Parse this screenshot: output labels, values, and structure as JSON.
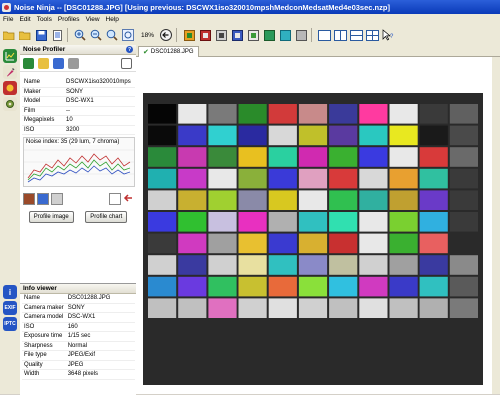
{
  "window": {
    "title": "Noise Ninja -- [DSC01288.JPG] [Using previous: DSCWX1iso320010mpshMedconMedsatMed4e03sec.nzp]"
  },
  "menu": [
    "File",
    "Edit",
    "Tools",
    "Profiles",
    "View",
    "Help"
  ],
  "toolbar": {
    "zoom": "18%"
  },
  "left_strip": {
    "exif": "EXIF",
    "iptc": "IPTC"
  },
  "noise_profiler": {
    "title": "Noise Profiler",
    "help": "?",
    "rows": [
      {
        "key": "Name",
        "value": "DSCWX1iso320010mps"
      },
      {
        "key": "Maker",
        "value": "SONY"
      },
      {
        "key": "Model",
        "value": "DSC-WX1"
      },
      {
        "key": "Film",
        "value": "--"
      },
      {
        "key": "Megapixels",
        "value": "10"
      },
      {
        "key": "ISO",
        "value": "3200"
      }
    ],
    "noise_index": "Noise index:  35 (29 lum, 7 chroma)",
    "profile_image_button": "Profile image",
    "profile_chart_button": "Profile chart"
  },
  "info_viewer": {
    "title": "Info viewer",
    "rows": [
      {
        "key": "Name",
        "value": "DSC01288.JPG"
      },
      {
        "key": "Camera maker",
        "value": "SONY"
      },
      {
        "key": "Camera model",
        "value": "DSC-WX1"
      },
      {
        "key": "ISO",
        "value": "160"
      },
      {
        "key": "Exposure time",
        "value": "1/15 sec"
      },
      {
        "key": "Sharpness",
        "value": "Normal"
      },
      {
        "key": "File type",
        "value": "JPEG/Exif"
      },
      {
        "key": "Quality",
        "value": "JPEG"
      },
      {
        "key": "Width",
        "value": "3648 pixels"
      }
    ]
  },
  "tab": {
    "label": "DSC01288.JPG"
  },
  "colors": {
    "chart": [
      [
        "#050505",
        "#e8e8e8",
        "#7a7a7a",
        "#2a8b2a",
        "#d23a3a",
        "#c88a8a",
        "#3a3a9a",
        "#ff3aa0",
        "#e8e8e8",
        "#3a3a3a",
        "#606060"
      ],
      [
        "#0a0a0a",
        "#3a3ac8",
        "#30d0d0",
        "#2a2aa0",
        "#d8d8d8",
        "#c0c02a",
        "#5a3aa0",
        "#2ac8c0",
        "#e8e820",
        "#1a1a1a",
        "#4a4a4a"
      ],
      [
        "#2a8a3a",
        "#c83ab0",
        "#3a8a3a",
        "#e8c020",
        "#2ad0a0",
        "#d02ab0",
        "#3ab030",
        "#3a3ae0",
        "#e8e8e8",
        "#d83a3a",
        "#6a6a6a"
      ],
      [
        "#20b0b0",
        "#c83ac8",
        "#e8e8e8",
        "#8ab03a",
        "#3a3ad8",
        "#e0a0c0",
        "#d83a3a",
        "#d8d8d8",
        "#e8a030",
        "#30c0a0",
        "#3a3a3a"
      ],
      [
        "#d0d0d0",
        "#c8b030",
        "#a0d030",
        "#8a8aa8",
        "#d8c820",
        "#e8e8e8",
        "#30c050",
        "#30b0a0",
        "#c0a030",
        "#6a3ac8",
        "#3a3a3a"
      ],
      [
        "#3a3ae0",
        "#30c030",
        "#c8c0e0",
        "#e830c0",
        "#b0b0b0",
        "#30c0c0",
        "#30e0b0",
        "#e8e8e8",
        "#7ad030",
        "#30b0e0",
        "#3a3a3a"
      ],
      [
        "#3a3a3a",
        "#d03ac0",
        "#a0a0a0",
        "#e8c030",
        "#3a3ad0",
        "#d8b030",
        "#c83030",
        "#e8e8e8",
        "#3ab030",
        "#e86060",
        "#2a2a2a"
      ],
      [
        "#d0d0d0",
        "#3a3aa0",
        "#d0d0d0",
        "#e8e0a0",
        "#30c0c0",
        "#8a8ac8",
        "#c0c0a0",
        "#d0d0d0",
        "#a0a0a0",
        "#3a3aa0",
        "#8a8a8a"
      ],
      [
        "#2a8ad0",
        "#6a3ae0",
        "#30c060",
        "#c8c030",
        "#e86a3a",
        "#8ae03a",
        "#30c0e0",
        "#d03ac0",
        "#3a3ac8",
        "#30c0c0",
        "#5a5a5a"
      ],
      [
        "#c0c0c0",
        "#c0c0c0",
        "#e070c0",
        "#d0d0d0",
        "#e0e0e0",
        "#d0d0d0",
        "#c0c0c0",
        "#e0e0e0",
        "#c0c0c0",
        "#b0b0b0",
        "#7a7a7a"
      ]
    ]
  }
}
